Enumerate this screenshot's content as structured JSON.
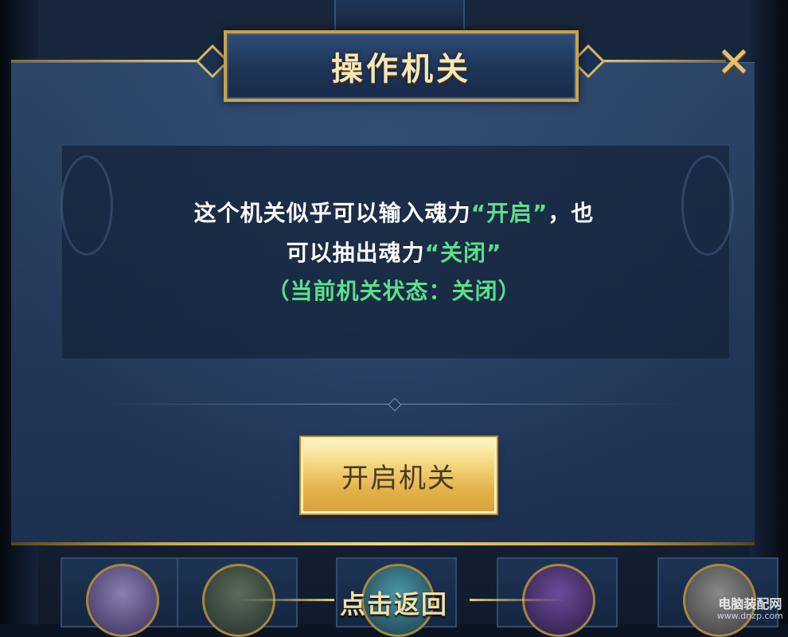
{
  "dialog": {
    "title": "操作机关",
    "close_glyph": "✕",
    "message": {
      "line1_prefix": "这个机关似乎可以输入魂力",
      "line1_highlight": "“开启”",
      "line1_suffix": "，也",
      "line2_prefix": "可以抽出魂力",
      "line2_highlight": "“关闭”",
      "status": "（当前机关状态：关闭）"
    },
    "action_button": "开启机关"
  },
  "footer": {
    "back_label": "点击返回"
  },
  "watermark": {
    "title": "电脑装配网",
    "url": "www.dnzp.com"
  },
  "colors": {
    "gold": "#c9a24a",
    "highlight_green": "#5be08a",
    "panel_blue": "#243a5a"
  }
}
